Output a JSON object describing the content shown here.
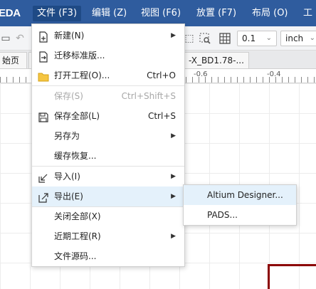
{
  "app": {
    "brand": "EDA"
  },
  "menubar": {
    "items": [
      {
        "label": "文件 (F3)"
      },
      {
        "label": "编辑 (Z)"
      },
      {
        "label": "视图 (F6)"
      },
      {
        "label": "放置 (F7)"
      },
      {
        "label": "布局 (O)"
      },
      {
        "label": "工"
      }
    ]
  },
  "toolbar": {
    "grid_select": "0.1",
    "unit_select": "inch"
  },
  "tabs": [
    {
      "label": "始页"
    },
    {
      "label": "‡"
    },
    {
      "label": "-X_BD1.78-..."
    }
  ],
  "ruler": {
    "labels": [
      "-0.6",
      "-0.4"
    ]
  },
  "file_menu": {
    "items": [
      {
        "label": "新建(N)",
        "icon": "new-icon",
        "submenu": true
      },
      {
        "label": "迁移标准版...",
        "icon": "migrate-icon"
      },
      {
        "label": "打开工程(O)...",
        "icon": "folder-icon",
        "shortcut": "Ctrl+O"
      },
      {
        "label": "保存(S)",
        "shortcut": "Ctrl+Shift+S",
        "disabled": true
      },
      {
        "label": "保存全部(L)",
        "icon": "save-icon",
        "shortcut": "Ctrl+S"
      },
      {
        "label": "另存为",
        "submenu": true
      },
      {
        "label": "缓存恢复..."
      },
      {
        "label": "导入(I)",
        "icon": "import-icon",
        "submenu": true
      },
      {
        "label": "导出(E)",
        "icon": "export-icon",
        "submenu": true,
        "highlighted": true
      },
      {
        "label": "关闭全部(X)"
      },
      {
        "label": "近期工程(R)",
        "submenu": true
      },
      {
        "label": "文件源码..."
      }
    ]
  },
  "export_submenu": {
    "items": [
      {
        "label": "Altium Designer...",
        "highlighted": true
      },
      {
        "label": "PADS..."
      }
    ]
  },
  "colors": {
    "menubar_bg": "#2f5c9e",
    "highlight_bg": "#e4f1fb",
    "board_outline": "#8b0000"
  }
}
